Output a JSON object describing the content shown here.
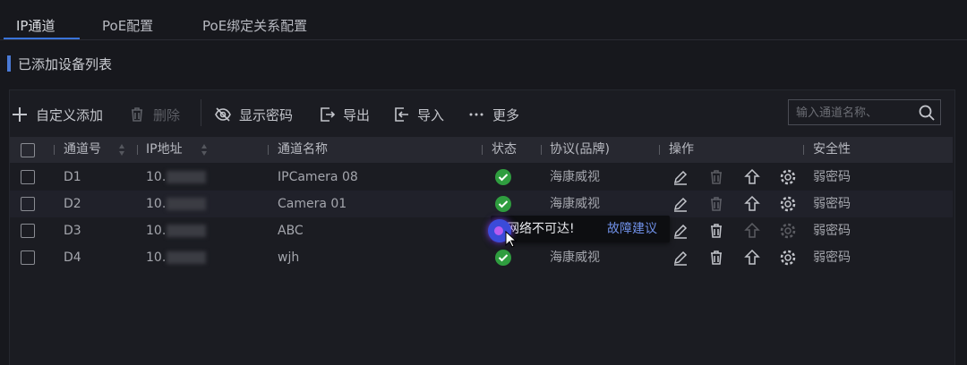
{
  "tabs": [
    {
      "label": "IP通道",
      "active": true
    },
    {
      "label": "PoE配置",
      "active": false
    },
    {
      "label": "PoE绑定关系配置",
      "active": false
    }
  ],
  "section_title": "已添加设备列表",
  "toolbar": {
    "add_label": "自定义添加",
    "delete_label": "删除",
    "show_password_label": "显示密码",
    "export_label": "导出",
    "import_label": "导入",
    "more_label": "更多"
  },
  "search": {
    "placeholder": "输入通道名称、"
  },
  "columns": {
    "channel_no": "通道号",
    "ip": "IP地址",
    "name": "通道名称",
    "status": "状态",
    "protocol": "协议(品牌)",
    "operation": "操作",
    "security": "安全性"
  },
  "rows": [
    {
      "channel": "D1",
      "ip_prefix": "10.",
      "name": "IPCamera 08",
      "status": "online",
      "protocol": "海康威视",
      "security": "弱密码"
    },
    {
      "channel": "D2",
      "ip_prefix": "10.",
      "name": "Camera 01",
      "status": "online",
      "protocol": "海康威视",
      "security": "弱密码"
    },
    {
      "channel": "D3",
      "ip_prefix": "10.",
      "name": "ABC",
      "status": "offline",
      "protocol": "",
      "security": "弱密码"
    },
    {
      "channel": "D4",
      "ip_prefix": "10.",
      "name": "wjh",
      "status": "online",
      "protocol": "海康威视",
      "security": "弱密码"
    }
  ],
  "tooltip": {
    "message": "网络不可达!",
    "link": "故障建议"
  },
  "colors": {
    "accent": "#3a73d9",
    "online": "#2f9d3f",
    "offline": "#3b4bd9",
    "link": "#6f8fe6"
  }
}
